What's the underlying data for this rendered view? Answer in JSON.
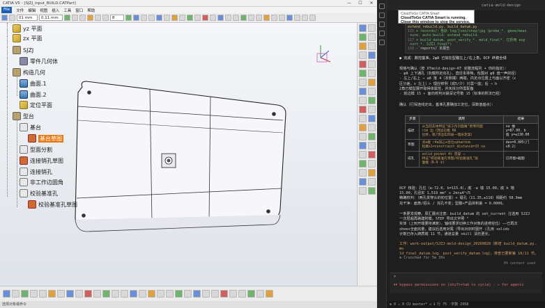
{
  "catia": {
    "title": "CATIA V5 - [SJZJ_input_BUILD.CATPart]",
    "menu": [
      "File",
      "文件",
      "编辑",
      "视图",
      "插入",
      "工具",
      "窗口",
      "帮助"
    ],
    "toolbar": {
      "select1": "01 mm",
      "select2": "0.11 mm",
      "select3": "8"
    },
    "status": "选择对象或命令",
    "tree": [
      {
        "label": "yz 平面",
        "icon": "plane-icon"
      },
      {
        "label": "zx 平面",
        "icon": "plane-icon"
      },
      {
        "label": "SJZJ",
        "icon": "part-icon"
      },
      {
        "label": "零件几何体",
        "icon": "body-icon"
      },
      {
        "label": "构造几何",
        "icon": "geoset-icon"
      },
      {
        "label": "曲面.1",
        "icon": "surface-icon"
      },
      {
        "label": "曲面.2",
        "icon": "surface-icon"
      },
      {
        "label": "定位平面",
        "icon": "plane-icon"
      },
      {
        "label": "型台",
        "icon": "geoset-icon"
      },
      {
        "label": "基台",
        "icon": "pad-icon"
      },
      {
        "label": "基台草图",
        "icon": "sketch-icon",
        "highlighted": true
      },
      {
        "label": "型面分割",
        "icon": "split-icon"
      },
      {
        "label": "连接销孔草图",
        "icon": "sketch-icon"
      },
      {
        "label": "连接销孔",
        "icon": "hole-icon"
      },
      {
        "label": "非工作边圆角",
        "icon": "fillet-icon"
      },
      {
        "label": "校验基准孔",
        "icon": "hole-icon"
      },
      {
        "label": "校验基准孔草图",
        "icon": "sketch-icon"
      }
    ]
  },
  "vscode": {
    "tab_title": "catia-mold-design",
    "popup": {
      "app": "CloudToGo CATIA Smart",
      "line1": "CloudToGo CATIA Smart is running.",
      "line2": "Close this window to stop the service."
    },
    "code": [
      {
        "n": "115",
        "t": "+ records/：各轨 log/json/step/jpg（probe_*. geom/meas"
      },
      {
        "n": "",
        "t": "+ure. auto-build. extend_rebuild."
      },
      {
        "n": "117",
        "t": "+ build_datum. post_verify_*. mold_final*. 它折用 exp"
      },
      {
        "n": "",
        "t": "+ort_*. SJZJ_final*)"
      },
      {
        "n": "118",
        "t": "- reports/ 本报告"
      }
    ],
    "code_head": "extend_rebuild.py. build_datum.py",
    "msg1": "● 完成：数控基准，2φ8 已加在型腹左上/右上角，OCP 终稳全绿",
    "msg2": "规格与确认（按 XTmold-design-KT 完整流程列 + 你的指定）：",
    "msg3": "- φ8 上下通孔（向载附定向孔）、直径本排档，包围对 φ8 值一声的径）",
    "msg4": "- 左上/右上 → a8 落 4（本侧端）两端，内定点位置上与面以齐密（x",
    "msg5": "区分差，x 左上）> 理应修例（成5/介）只需一座；后 → b",
    "msg6": "2角已模型展开取得体属性，并未拆分所需配备",
    "msg7": "- 前边模 15 ÷ 面向校判对最深记号数 15（标准的附法已经）",
    "msg8": "确认（打保连线定出，基准孔要确加工定位，深数值基点）：",
    "table": {
      "headers": [
        "步骤",
        "调用",
        "结果"
      ],
      "rows": [
        [
          "描述",
          "从当前实体特征\"技工作识面角\"把零的面\nrim 边（顶边已框 R6\n位移，底/顶边实际层一理床定案）",
          "xa 维\ny=87.00. b\n值 y=±130.00"
        ],
        [
          "草图",
          "点a框 r4a同心+反位sphantom\n轮廓x1=constraint_distance=15 xa",
          "dev=0.005(门\nx0.2)"
        ],
        [
          "成孔",
          "solid_pocket 4t 贯穿 →\n特征\"校验基准孔草图/校验基准孔\"层\n面框（R-0 ①）",
          "已存盘+截图"
        ]
      ]
    },
    "msg9": "OCP 核验：孔位（a-72.0, b=115.0），底 -a 墙 15.00，底 b 墙",
    "msg10": "15.00；孔径实 1,519 mm² ≈ 2πr±4²√5",
    "msg11": "精确校判：（两孔贯穿头的初位置）+ 碰孔（11.35,±110）相距约 58.9mm",
    "msg12": "充干净：面角/招头 / 完孔不变；型腹+产品体积差 = 0.0000。",
    "msg13": "一条更发观察。原汇展点注意：build_datum 的 set_current 注选用 SJZJ",
    "msg14": "一次层超再路建附模。STEP 导出文字照  \"",
    "msg15": "实体（上到开端要持满复），轴线要求切换工作对象的进修控位）——已再次",
    "msg16": "shoes全面完量，建议后选用对尾（导出对旧时图开 (孔用 solids",
    "msg17": "计数已存入牌质端 11 节，通道总量 skill 清仍更长。",
    "msg18": "工作：work-output/SJZJ-mold-design_20260828（新增 build_datum.py. mo",
    "msg19": "ld_final_datum.log. post_verify_datum.log），排查已更新第 10/11 节。",
    "msg20": "✻ Crunched for 5m 39s",
    "ctx": "0% context used",
    "prompt": ">",
    "bypass": "⏵⏵ bypass permissions on (shift+tab to cycle) · ← for agents",
    "statusbar": "⊗ 0 ⚠ 0   CU  master*   ⌂   ℹ   行 75 ·字数 2958"
  },
  "colors": {
    "highlight": "#e87810",
    "popup_bg": "#ffffff",
    "vscode_bg": "#1e1e1e"
  }
}
